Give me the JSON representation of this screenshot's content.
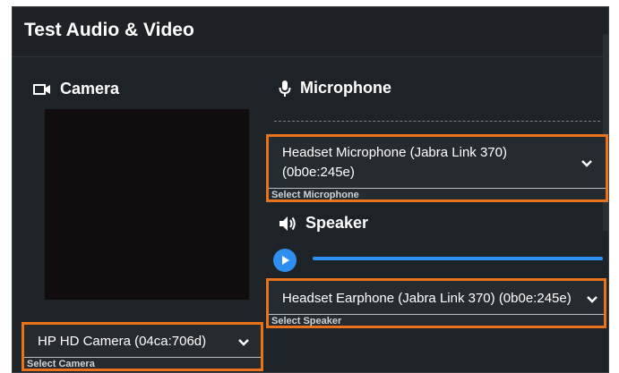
{
  "dialog": {
    "title": "Test Audio & Video"
  },
  "camera": {
    "heading": "Camera",
    "icon": "video-camera-icon",
    "selected": "HP HD Camera (04ca:706d)",
    "caption": "Select Camera"
  },
  "microphone": {
    "heading": "Microphone",
    "icon": "microphone-icon",
    "selected_line1": "Headset Microphone (Jabra Link 370)",
    "selected_line2": "(0b0e:245e)",
    "caption": "Select Microphone"
  },
  "speaker": {
    "heading": "Speaker",
    "icon": "speaker-icon",
    "selected": "Headset Earphone (Jabra Link 370) (0b0e:245e)",
    "caption": "Select Speaker",
    "playback_progress": 1.0
  },
  "colors": {
    "background": "#1e2328",
    "highlight": "#e8731a",
    "accent": "#2f8ff0",
    "text": "#ffffff"
  }
}
